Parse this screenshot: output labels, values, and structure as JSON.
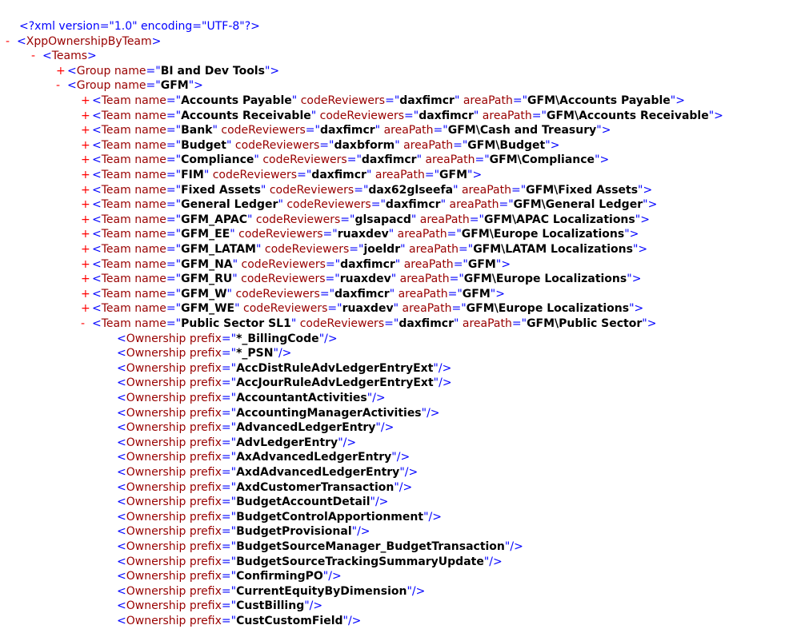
{
  "declaration": "<?xml version=\"1.0\" encoding=\"UTF-8\"?>",
  "root": {
    "toggle": "-",
    "tag": "XppOwnershipByTeam"
  },
  "teams_node": {
    "toggle": "-",
    "tag": "Teams"
  },
  "group_bi": {
    "toggle": "+",
    "tag": "Group",
    "attr": "name",
    "value": "BI and Dev Tools"
  },
  "group_gfm": {
    "toggle": "-",
    "tag": "Group",
    "attr": "name",
    "value": "GFM"
  },
  "teams": [
    {
      "toggle": "+",
      "name": "Accounts Payable",
      "codeReviewers": "daxfimcr",
      "areaPath": "GFM\\Accounts Payable"
    },
    {
      "toggle": "+",
      "name": "Accounts Receivable",
      "codeReviewers": "daxfimcr",
      "areaPath": "GFM\\Accounts Receivable"
    },
    {
      "toggle": "+",
      "name": "Bank",
      "codeReviewers": "daxfimcr",
      "areaPath": "GFM\\Cash and Treasury"
    },
    {
      "toggle": "+",
      "name": "Budget",
      "codeReviewers": "daxbform",
      "areaPath": "GFM\\Budget"
    },
    {
      "toggle": "+",
      "name": "Compliance",
      "codeReviewers": "daxfimcr",
      "areaPath": "GFM\\Compliance"
    },
    {
      "toggle": "+",
      "name": "FIM",
      "codeReviewers": "daxfimcr",
      "areaPath": "GFM"
    },
    {
      "toggle": "+",
      "name": "Fixed Assets",
      "codeReviewers": "dax62glseefa",
      "areaPath": "GFM\\Fixed Assets"
    },
    {
      "toggle": "+",
      "name": "General Ledger",
      "codeReviewers": "daxfimcr",
      "areaPath": "GFM\\General Ledger"
    },
    {
      "toggle": "+",
      "name": "GFM_APAC",
      "codeReviewers": "glsapacd",
      "areaPath": "GFM\\APAC Localizations"
    },
    {
      "toggle": "+",
      "name": "GFM_EE",
      "codeReviewers": "ruaxdev",
      "areaPath": "GFM\\Europe Localizations"
    },
    {
      "toggle": "+",
      "name": "GFM_LATAM",
      "codeReviewers": "joeldr",
      "areaPath": "GFM\\LATAM Localizations"
    },
    {
      "toggle": "+",
      "name": "GFM_NA",
      "codeReviewers": "daxfimcr",
      "areaPath": "GFM"
    },
    {
      "toggle": "+",
      "name": "GFM_RU",
      "codeReviewers": "ruaxdev",
      "areaPath": "GFM\\Europe Localizations"
    },
    {
      "toggle": "+",
      "name": "GFM_W",
      "codeReviewers": "daxfimcr",
      "areaPath": "GFM"
    },
    {
      "toggle": "+",
      "name": "GFM_WE",
      "codeReviewers": "ruaxdev",
      "areaPath": "GFM\\Europe Localizations"
    },
    {
      "toggle": "-",
      "name": "Public Sector SL1",
      "codeReviewers": "daxfimcr",
      "areaPath": "GFM\\Public Sector"
    }
  ],
  "labels": {
    "team_tag": "Team",
    "attr_name": "name",
    "attr_reviewers": "codeReviewers",
    "attr_area": "areaPath",
    "ownership_tag": "Ownership",
    "attr_prefix": "prefix"
  },
  "ownerships": [
    "*_BillingCode",
    "*_PSN",
    "AccDistRuleAdvLedgerEntryExt",
    "AccJourRuleAdvLedgerEntryExt",
    "AccountantActivities",
    "AccountingManagerActivities",
    "AdvancedLedgerEntry",
    "AdvLedgerEntry",
    "AxAdvancedLedgerEntry",
    "AxdAdvancedLedgerEntry",
    "AxdCustomerTransaction",
    "BudgetAccountDetail",
    "BudgetControlApportionment",
    "BudgetProvisional",
    "BudgetSourceManager_BudgetTransaction",
    "BudgetSourceTrackingSummaryUpdate",
    "ConfirmingPO",
    "CurrentEquityByDimension",
    "CustBilling",
    "CustCustomField"
  ]
}
